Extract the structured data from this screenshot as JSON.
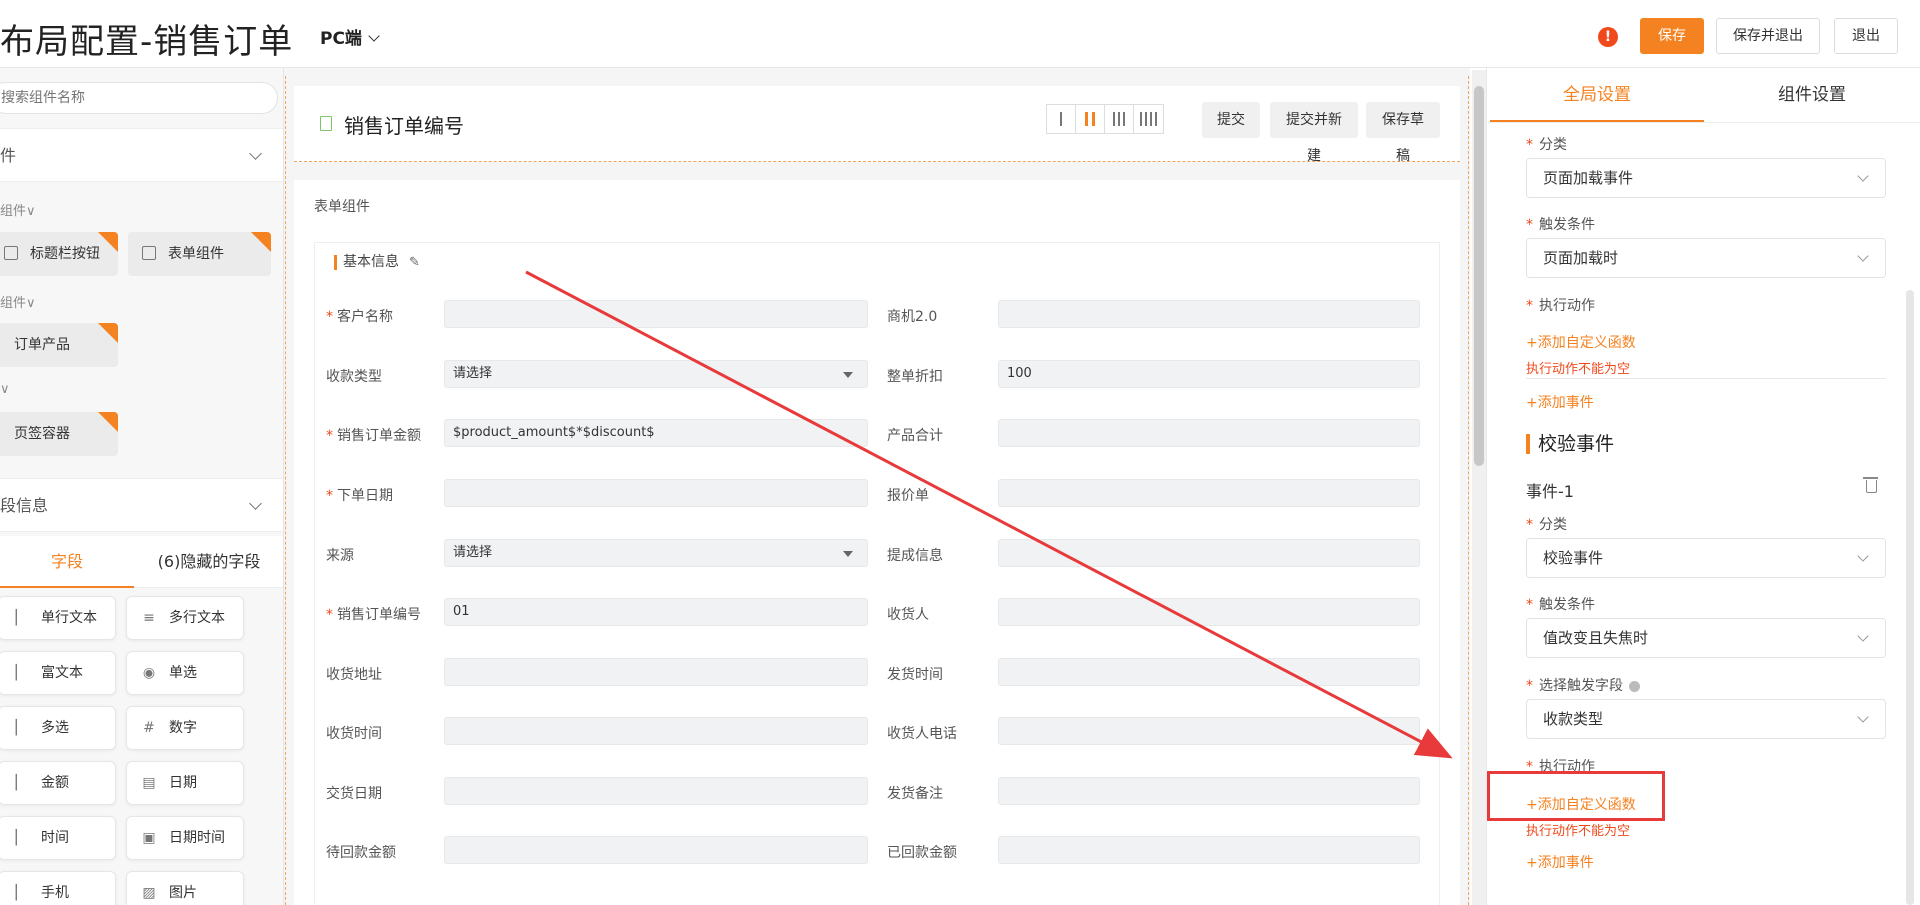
{
  "header": {
    "title": "布局配置-销售订单",
    "platform": "PC端",
    "buttons": {
      "save": "保存",
      "save_exit": "保存并退出",
      "exit": "退出"
    },
    "warning_glyph": "!"
  },
  "left": {
    "search_placeholder": "搜索组件名称",
    "section1": "件",
    "groups": [
      "组件∨",
      "组件∨",
      "∨"
    ],
    "components": [
      {
        "label": "标题栏按钮"
      },
      {
        "label": "表单组件"
      },
      {
        "label": "订单产品"
      },
      {
        "label": "页签容器"
      }
    ],
    "section2": "段信息",
    "field_tabs": {
      "fields": "字段",
      "hidden": "(6)隐藏的字段"
    },
    "fields": [
      {
        "label": "单行文本",
        "icon": "text-line"
      },
      {
        "label": "多行文本",
        "icon": "≡"
      },
      {
        "label": "富文本",
        "icon": "rich-text"
      },
      {
        "label": "单选",
        "icon": "◉"
      },
      {
        "label": "多选",
        "icon": "checkbox"
      },
      {
        "label": "数字",
        "icon": "#"
      },
      {
        "label": "金额",
        "icon": "money"
      },
      {
        "label": "日期",
        "icon": "▤"
      },
      {
        "label": "时间",
        "icon": "clock"
      },
      {
        "label": "日期时间",
        "icon": "▣"
      },
      {
        "label": "手机",
        "icon": "phone"
      },
      {
        "label": "图片",
        "icon": "▨"
      }
    ]
  },
  "canvas": {
    "head_title": "销售订单编号",
    "buttons": {
      "submit": "提交",
      "submit_new": "提交并新建",
      "draft": "保存草稿"
    },
    "form_label": "表单组件",
    "subsection": "基本信息",
    "subsection_edit": "✎",
    "rows": [
      {
        "l_label": "客户名称",
        "l_req": true,
        "l_value": "",
        "l_select": false,
        "r_label": "商机2.0",
        "r_value": ""
      },
      {
        "l_label": "收款类型",
        "l_req": false,
        "l_value": "请选择",
        "l_select": true,
        "r_label": "整单折扣",
        "r_value": "100"
      },
      {
        "l_label": "销售订单金额",
        "l_req": true,
        "l_value": "$product_amount$*$discount$",
        "l_select": false,
        "r_label": "产品合计",
        "r_value": ""
      },
      {
        "l_label": "下单日期",
        "l_req": true,
        "l_value": "",
        "l_select": false,
        "r_label": "报价单",
        "r_value": ""
      },
      {
        "l_label": "来源",
        "l_req": false,
        "l_value": "请选择",
        "l_select": true,
        "r_label": "提成信息",
        "r_value": ""
      },
      {
        "l_label": "销售订单编号",
        "l_req": true,
        "l_value": "01",
        "l_select": false,
        "r_label": "收货人",
        "r_value": ""
      },
      {
        "l_label": "收货地址",
        "l_req": false,
        "l_value": "",
        "l_select": false,
        "r_label": "发货时间",
        "r_value": ""
      },
      {
        "l_label": "收货时间",
        "l_req": false,
        "l_value": "",
        "l_select": false,
        "r_label": "收货人电话",
        "r_value": ""
      },
      {
        "l_label": "交货日期",
        "l_req": false,
        "l_value": "",
        "l_select": false,
        "r_label": "发货备注",
        "r_value": ""
      },
      {
        "l_label": "待回款金额",
        "l_req": false,
        "l_value": "",
        "l_select": false,
        "r_label": "已回款金额",
        "r_value": ""
      }
    ]
  },
  "right": {
    "tabs": {
      "global": "全局设置",
      "component": "组件设置"
    },
    "event1": {
      "category_label": "分类",
      "category_value": "页面加载事件",
      "trigger_label": "触发条件",
      "trigger_value": "页面加载时",
      "action_label": "执行动作",
      "add_function": "+添加自定义函数",
      "error": "执行动作不能为空",
      "add_event": "+添加事件"
    },
    "validation_section": "校验事件",
    "event_name": "事件-1",
    "event2": {
      "category_label": "分类",
      "category_value": "校验事件",
      "trigger_label": "触发条件",
      "trigger_value": "值改变且失焦时",
      "field_label": "选择触发字段",
      "field_value": "收款类型",
      "action_label": "执行动作",
      "add_function": "+添加自定义函数",
      "error": "执行动作不能为空",
      "add_event": "+添加事件"
    }
  },
  "colors": {
    "accent": "#f58220",
    "error": "#f04a1c",
    "annotation": "#e83a3a"
  }
}
